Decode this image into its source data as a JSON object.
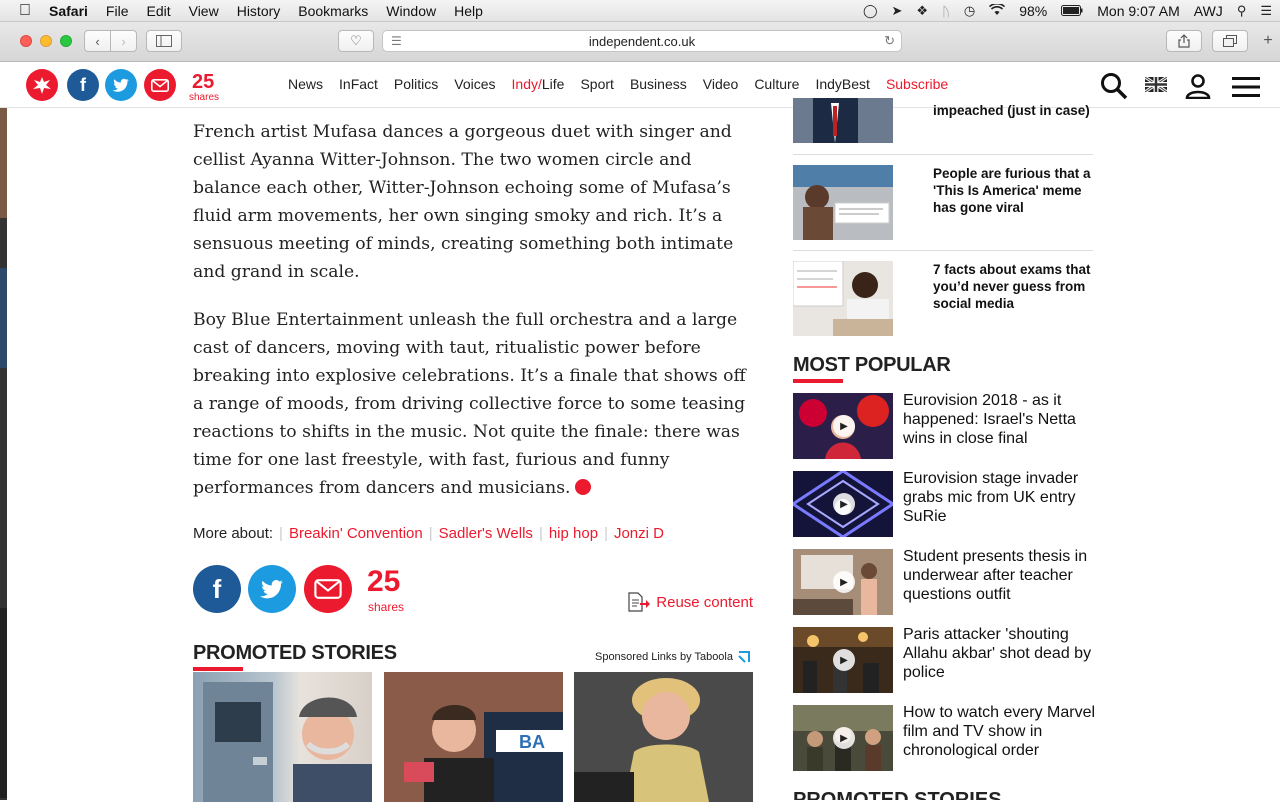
{
  "menubar": {
    "app": "Safari",
    "items": [
      "File",
      "Edit",
      "View",
      "History",
      "Bookmarks",
      "Window",
      "Help"
    ],
    "battery": "98%",
    "clock": "Mon 9:07 AM",
    "user": "AWJ"
  },
  "browser": {
    "url": "independent.co.uk"
  },
  "site": {
    "share_count": "25",
    "share_label": "shares",
    "nav": [
      "News",
      "InFact",
      "Politics",
      "Voices",
      "Indy/Life",
      "Sport",
      "Business",
      "Video",
      "Culture",
      "IndyBest",
      "Subscribe"
    ],
    "nav_indy_prefix": "Indy/",
    "nav_indy_suffix": "Life"
  },
  "article": {
    "paragraph1": "French artist Mufasa dances a gorgeous duet with singer and cellist Ayanna Witter-Johnson. The two women circle and balance each other, Witter-Johnson echoing some of Mufasa’s fluid arm movements, her own singing smoky and rich. It’s a sensuous meeting of minds, creating something both intimate and grand in scale.",
    "paragraph2": "Boy Blue Entertainment unleash the full orchestra and a large cast of dancers, moving with taut, ritualistic power before breaking into explosive celebrations. It’s a finale that shows off a range of moods, from driving collective force to some teasing reactions to shifts in the music. Not quite the finale: there was time for one last freestyle, with fast, furious and funny performances from dancers and musicians."
  },
  "more_about": {
    "label": "More about:",
    "tags": [
      "Breakin' Convention",
      "Sadler's Wells",
      "hip hop",
      "Jonzi D"
    ]
  },
  "shares_bottom": {
    "count": "25",
    "label": "shares",
    "reuse": "Reuse content"
  },
  "promoted": {
    "title": "PROMOTED STORIES",
    "taboola": "Sponsored Links by Taboola",
    "sign_text": "BA"
  },
  "sidebar": {
    "related": [
      {
        "title": "impeached (just in case)"
      },
      {
        "title": "People are furious that a 'This Is America' meme has gone viral"
      },
      {
        "title": "7 facts about exams that you’d never guess from social media"
      }
    ],
    "most_popular_title": "MOST POPULAR",
    "most_popular": [
      {
        "title": "Eurovision 2018 - as it happened: Israel's Netta wins in close final"
      },
      {
        "title": "Eurovision stage invader grabs mic from UK entry SuRie"
      },
      {
        "title": "Student presents thesis in underwear after teacher questions outfit"
      },
      {
        "title": "Paris attacker 'shouting Allahu akbar' shot dead by police"
      },
      {
        "title": "How to watch every Marvel film and TV show in chronological order"
      }
    ],
    "bottom_title": "PROMOTED STORIES"
  },
  "colors": {
    "brand_red": "#ec1a2e",
    "facebook": "#1d5a97",
    "twitter": "#1d9be1"
  }
}
